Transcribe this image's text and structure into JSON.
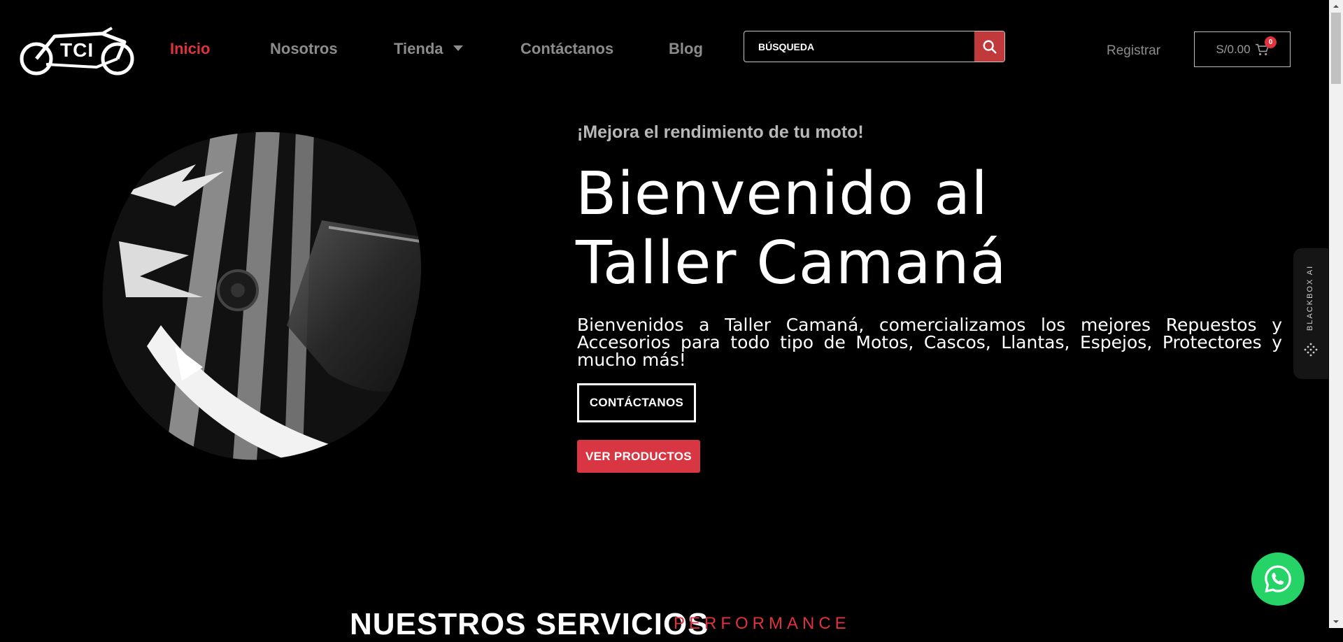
{
  "brand": {
    "logo_text": "TCI"
  },
  "nav": {
    "items": [
      {
        "label": "Inicio",
        "active": true
      },
      {
        "label": "Nosotros",
        "active": false
      },
      {
        "label": "Tienda",
        "active": false,
        "has_dropdown": true
      },
      {
        "label": "Contáctanos",
        "active": false
      },
      {
        "label": "Blog",
        "active": false
      }
    ]
  },
  "search": {
    "placeholder": "BÚSQUEDA",
    "icon": "search-icon"
  },
  "account": {
    "register_label": "Registrar"
  },
  "cart": {
    "amount": "S/0.00",
    "count": "0",
    "icon": "cart-icon"
  },
  "hero": {
    "eyebrow": "¡Mejora el rendimiento de tu moto!",
    "title_line1": "Bienvenido al",
    "title_line2": "Taller Camaná",
    "description": "Bienvenidos a Taller Camaná, comercializamos los mejores Repuestos y Accesorios para todo tipo de Motos, Cascos, Llantas, Espejos, Protectores y mucho más!",
    "primary_button": "CONTÁCTANOS",
    "secondary_button": "VER PRODUCTOS"
  },
  "services": {
    "title": "NUESTROS SERVICIOS",
    "subtitle": "PERFORMANCE"
  },
  "side_tab": {
    "label": "BLACKBOX AI"
  },
  "colors": {
    "accent": "#e0323e",
    "background": "#000000",
    "nav_inactive": "#8c8c8c",
    "whatsapp": "#25d366"
  }
}
